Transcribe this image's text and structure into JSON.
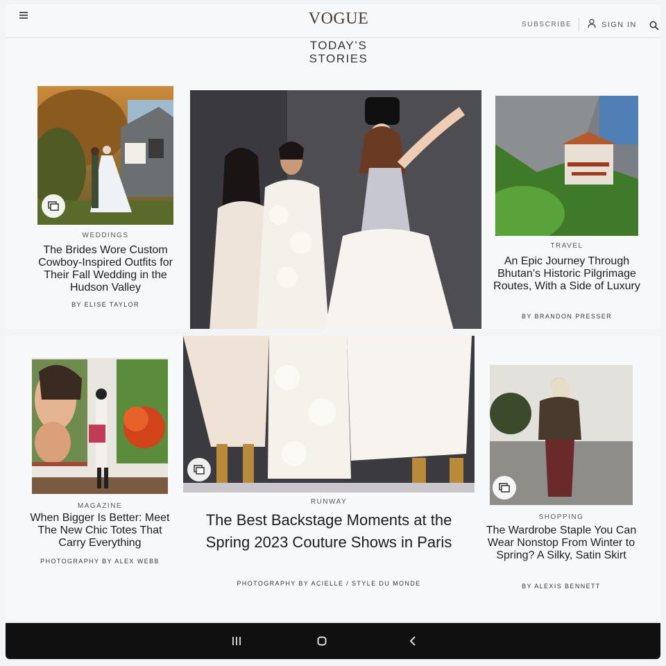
{
  "header": {
    "logo": "VOGUE",
    "subscribe": "SUBSCRIBE",
    "sign_in": "SIGN IN",
    "section_title_line1": "TODAY’S",
    "section_title_line2": "STORIES"
  },
  "stories": {
    "weddings": {
      "category": "WEDDINGS",
      "headline": "The Brides Wore Custom Cowboy-Inspired Outfits for Their Fall Wedding in the Hudson Valley",
      "byline": "BY ELISE TAYLOR"
    },
    "travel": {
      "category": "TRAVEL",
      "headline": "An Epic Journey Through Bhutan’s Historic Pilgrimage Routes, With a Side of Luxury",
      "byline": "BY BRANDON PRESSER"
    },
    "magazine": {
      "category": "MAGAZINE",
      "headline": "When Bigger Is Better: Meet The New Chic Totes That Carry Everything",
      "byline": "PHOTOGRAPHY BY ALEX WEBB"
    },
    "runway": {
      "category": "RUNWAY",
      "headline": "The Best Backstage Moments at the Spring 2023 Couture Shows in Paris",
      "byline": "PHOTOGRAPHY BY ACIELLE / STYLE DU MONDE"
    },
    "shopping": {
      "category": "SHOPPING",
      "headline": "The Wardrobe Staple You Can Wear Nonstop From Winter to Spring? A Silky, Satin Skirt",
      "byline": "BY ALEXIS BENNETT"
    }
  },
  "colors": {
    "logo": "#4a3a32",
    "text": "#1b1b1b",
    "nav_bar": "#101010"
  },
  "icons": {
    "menu": "hamburger-icon",
    "user": "user-icon",
    "search": "search-icon",
    "gallery": "gallery-icon",
    "recents": "recents-icon",
    "home": "home-icon",
    "back": "back-icon"
  }
}
